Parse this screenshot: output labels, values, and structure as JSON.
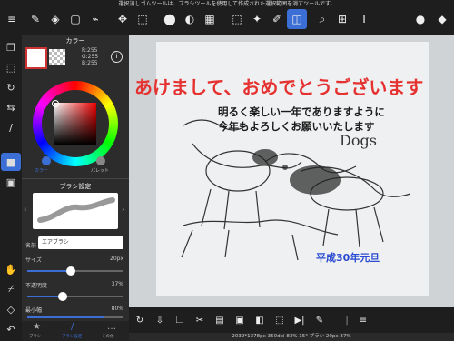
{
  "hint": "選択消しゴムツールは、ブラシツールを使用して作成された選択範囲を消すツールです。",
  "color_panel": {
    "title": "カラー",
    "rgb": [
      "R:255",
      "G:255",
      "B:255"
    ],
    "tab_color": "カラー",
    "tab_palette": "パレット"
  },
  "brush_panel": {
    "title": "ブラシ設定",
    "name_label": "名前",
    "name_value": "エアブラシ",
    "size_label": "サイズ",
    "size_value": "20px",
    "opacity_label": "不透明度",
    "opacity_value": "37%",
    "min_label": "最小幅",
    "min_value": "80%",
    "size_level": 0.45,
    "opacity_level": 0.37,
    "min_level": 0.8
  },
  "bottom_tabs": [
    "ブラシ",
    "ブラシ設定",
    "その他"
  ],
  "canvas_text": {
    "headline": "あけまして、おめでとうございます",
    "line1": "明るく楽しい一年でありますように",
    "line2": "今年もよろしくお願いいたします",
    "dogs": "Dogs",
    "date": "平成30年元旦"
  },
  "status": "2039*1378px 350dpi 83% 15° ブラシ 20px 37%",
  "colors": {
    "accent": "#3b6fd6",
    "headline": "#e5312f",
    "body": "#1a1a1a",
    "date": "#2a4bd1"
  }
}
